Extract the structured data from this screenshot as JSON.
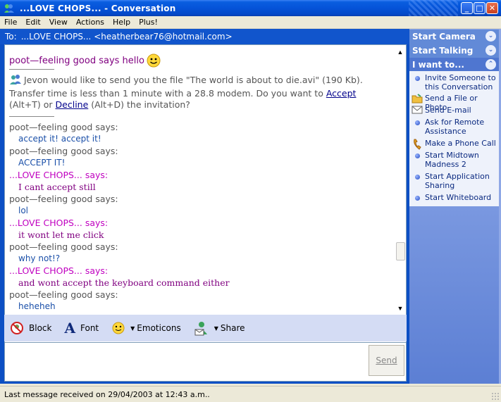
{
  "window": {
    "title": "...LOVE CHOPS... - Conversation",
    "controls": {
      "minimize": "_",
      "maximize": "□",
      "close": "✕"
    }
  },
  "menu": [
    "File",
    "Edit",
    "View",
    "Actions",
    "Help",
    "Plus!"
  ],
  "to_bar": {
    "label": "To:",
    "value": "...LOVE CHOPS... <heatherbear76@hotmail.com>"
  },
  "history": {
    "sys_message": {
      "name": "poot—feeling good says hello",
      "emoticon": "smiley-icon"
    },
    "invite": {
      "text_before": "Jevon would like to send you the file \"The world is about to die.avi\" (190 Kb). Transfer time is less than 1 minute with a 28.8 modem. Do you want to ",
      "accept_label": "Accept",
      "accept_hotkey": " (Alt+T) or ",
      "decline_label": "Decline",
      "after": " (Alt+D) the invitation?"
    },
    "messages": [
      {
        "speaker": "poot—feeling good says:",
        "text": "accept it! accept it!",
        "who": "poot"
      },
      {
        "speaker": "poot—feeling good says:",
        "text": "ACCEPT IT!",
        "who": "poot"
      },
      {
        "speaker": "...LOVE CHOPS... says:",
        "text": "I cant accept still",
        "who": "love"
      },
      {
        "speaker": "poot—feeling good says:",
        "text": "lol",
        "who": "poot"
      },
      {
        "speaker": "...LOVE CHOPS... says:",
        "text": "it wont let me click",
        "who": "love"
      },
      {
        "speaker": "poot—feeling good says:",
        "text": "why not!?",
        "who": "poot"
      },
      {
        "speaker": "...LOVE CHOPS... says:",
        "text": "and wont accept the keyboard command either",
        "who": "love"
      },
      {
        "speaker": "poot—feeling good says:",
        "text": "heheheh",
        "who": "poot"
      }
    ]
  },
  "toolbar": {
    "block": "Block",
    "font": "Font",
    "emoticons": "Emoticons",
    "share": "Share"
  },
  "compose": {
    "value": "",
    "send": "Send"
  },
  "status": "Last message received on 29/04/2003 at 12:43 a.m..",
  "sidebar": {
    "start_camera": "Start Camera",
    "start_talking": "Start Talking",
    "i_want_to": "I want to...",
    "items": [
      {
        "label": "Invite Someone to this Conversation",
        "icon": "bullet-icon"
      },
      {
        "label": "Send a File or Photo",
        "icon": "folder-icon"
      },
      {
        "label": "Send E-mail",
        "icon": "envelope-icon"
      },
      {
        "label": "Ask for Remote Assistance",
        "icon": "bullet-icon"
      },
      {
        "label": "Make a Phone Call",
        "icon": "phone-icon"
      },
      {
        "label": "Start Midtown Madness 2",
        "icon": "bullet-icon"
      },
      {
        "label": "Start Application Sharing",
        "icon": "bullet-icon"
      },
      {
        "label": "Start Whiteboard",
        "icon": "bullet-icon"
      }
    ]
  },
  "colors": {
    "titlebar": "#0553d8",
    "panel_blue": "#0c4fc4",
    "poot_text": "#1a4fa8",
    "love_text": "#800080",
    "love_speaker": "#c000c0"
  }
}
